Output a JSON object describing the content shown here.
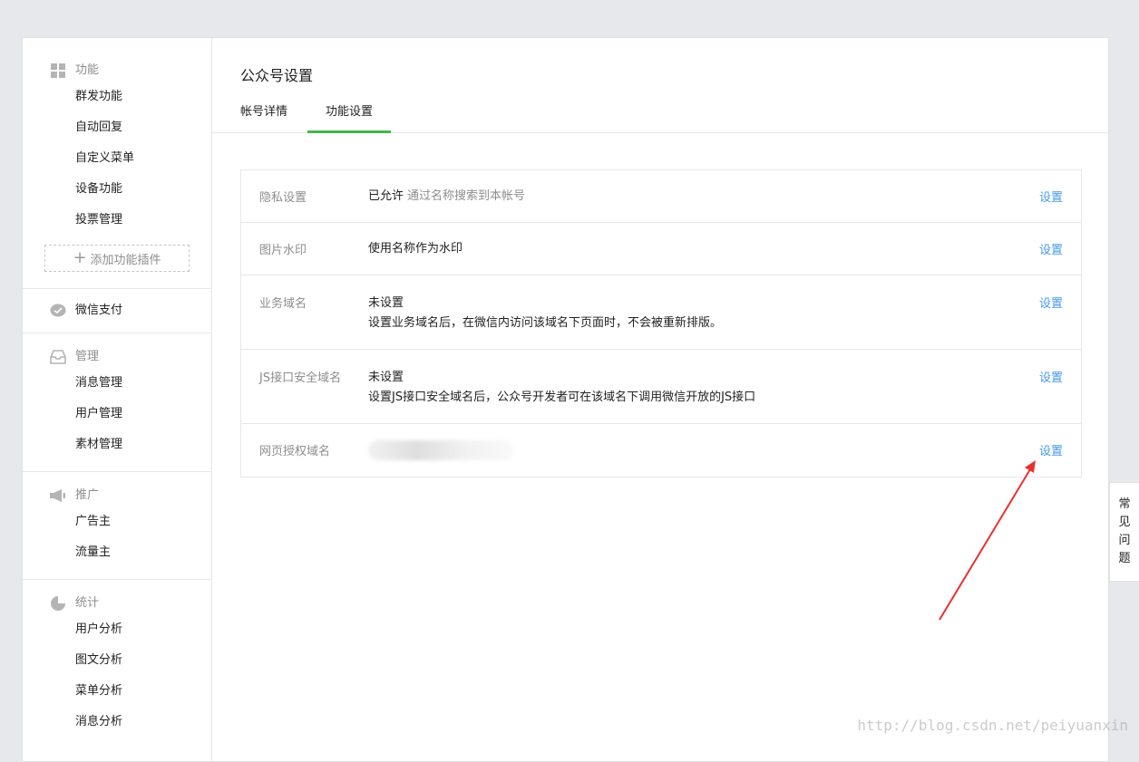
{
  "sidebar": {
    "groups": [
      {
        "title": "功能",
        "icon": "grid-icon",
        "items": [
          "群发功能",
          "自动回复",
          "自定义菜单",
          "设备功能",
          "投票管理"
        ],
        "add_plugin": "添加功能插件"
      },
      {
        "title": "微信支付",
        "icon": "wechat-pay-icon"
      },
      {
        "title": "管理",
        "icon": "inbox-icon",
        "items": [
          "消息管理",
          "用户管理",
          "素材管理"
        ]
      },
      {
        "title": "推广",
        "icon": "megaphone-icon",
        "items": [
          "广告主",
          "流量主"
        ]
      },
      {
        "title": "统计",
        "icon": "pie-chart-icon",
        "items": [
          "用户分析",
          "图文分析",
          "菜单分析",
          "消息分析"
        ]
      }
    ]
  },
  "main": {
    "title": "公众号设置",
    "tabs": [
      {
        "label": "帐号详情",
        "active": false
      },
      {
        "label": "功能设置",
        "active": true
      }
    ],
    "rows": [
      {
        "label": "隐私设置",
        "value": "已允许",
        "hint": "通过名称搜索到本帐号",
        "action": "设置"
      },
      {
        "label": "图片水印",
        "value": "使用名称作为水印",
        "action": "设置"
      },
      {
        "label": "业务域名",
        "value": "未设置",
        "desc": "设置业务域名后，在微信内访问该域名下页面时，不会被重新排版。",
        "action": "设置"
      },
      {
        "label": "JS接口安全域名",
        "value": "未设置",
        "desc": "设置JS接口安全域名后，公众号开发者可在该域名下调用微信开放的JS接口",
        "action": "设置"
      },
      {
        "label": "网页授权域名",
        "value_blurred": true,
        "action": "设置"
      }
    ]
  },
  "faq": {
    "chars": [
      "常",
      "见",
      "问",
      "题"
    ]
  },
  "watermark": "http://blog.csdn.net/peiyuanxin",
  "colors": {
    "accent": "#44b549",
    "link": "#459ae9",
    "muted": "#8d8d8d",
    "arrow": "#e8302e"
  }
}
